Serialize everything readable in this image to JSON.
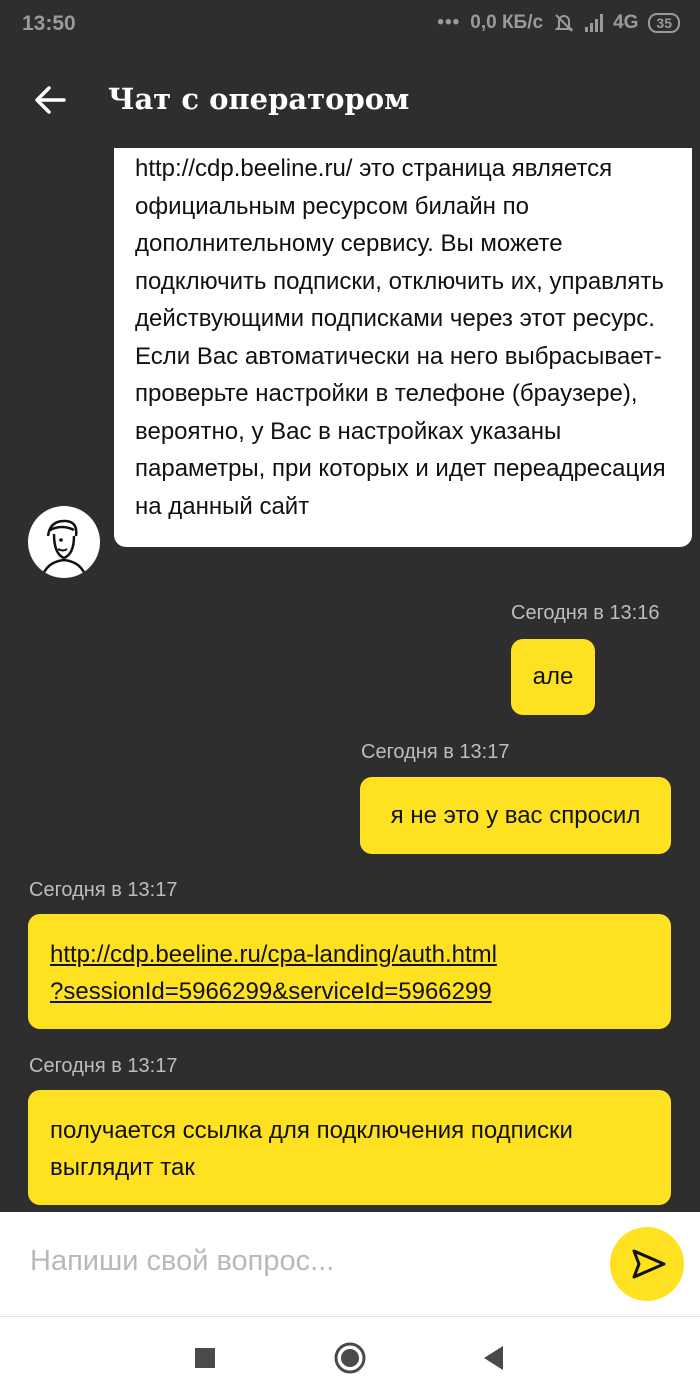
{
  "status_bar": {
    "time": "13:50",
    "dots": "•••",
    "speed": "0,0 КБ/с",
    "network": "4G",
    "battery": "35"
  },
  "header": {
    "title": "Чат с оператором"
  },
  "messages": {
    "operator_long": "http://cdp.beeline.ru/ это страница является официальным ресурсом билайн по дополнительному сервису. Вы можете подключить подписки, отключить их, управлять действующими подписками через этот ресурс. Если Вас автоматически на него выбрасывает- проверьте настройки в телефоне (браузере), вероятно, у Вас в настройках указаны параметры, при которых и идет переадресация на данный сайт",
    "ts1": "Сегодня в 13:16",
    "user1": "але",
    "ts2": "Сегодня в 13:17",
    "user2": "я не это у вас спросил",
    "ts3": "Сегодня в 13:17",
    "link_line1": "http://cdp.beeline.ru/cpa-landing/auth.html",
    "link_line2": "?sessionId=5966299&serviceId=5966299",
    "ts4": "Сегодня в 13:17",
    "user4": "получается ссылка для подключения подписки выглядит так"
  },
  "input": {
    "placeholder": "Напиши свой вопрос..."
  },
  "colors": {
    "background": "#2e2e2e",
    "accent": "#fee221",
    "operator_bubble": "#ffffff"
  }
}
